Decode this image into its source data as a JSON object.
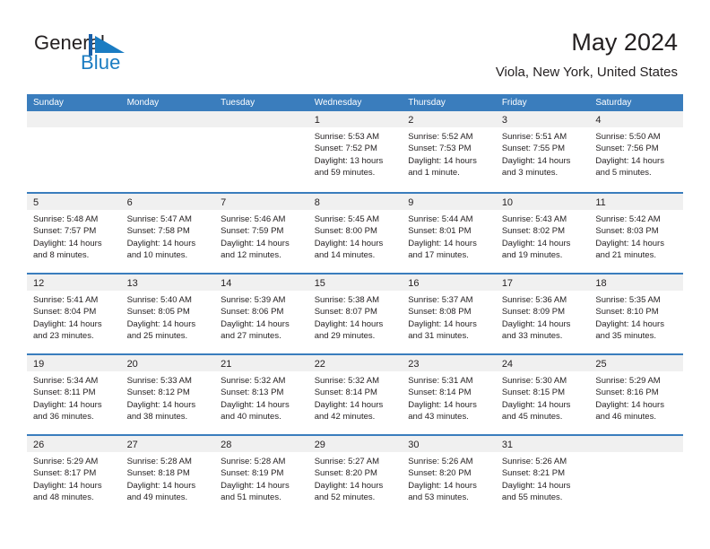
{
  "brand": {
    "name_part1": "General",
    "name_part2": "Blue",
    "logo_icon": "blue-triangle-flag-icon",
    "accent_color": "#1a7cc2"
  },
  "header": {
    "title": "May 2024",
    "subtitle": "Viola, New York, United States"
  },
  "theme": {
    "header_blue": "#3a7dbd",
    "day_strip_gray": "#f0f0f0",
    "text_color": "#231f20"
  },
  "calendar": {
    "weekdays": [
      "Sunday",
      "Monday",
      "Tuesday",
      "Wednesday",
      "Thursday",
      "Friday",
      "Saturday"
    ],
    "weeks": [
      [
        {
          "day": "",
          "lines": []
        },
        {
          "day": "",
          "lines": []
        },
        {
          "day": "",
          "lines": []
        },
        {
          "day": "1",
          "lines": [
            "Sunrise: 5:53 AM",
            "Sunset: 7:52 PM",
            "Daylight: 13 hours",
            "and 59 minutes."
          ]
        },
        {
          "day": "2",
          "lines": [
            "Sunrise: 5:52 AM",
            "Sunset: 7:53 PM",
            "Daylight: 14 hours",
            "and 1 minute."
          ]
        },
        {
          "day": "3",
          "lines": [
            "Sunrise: 5:51 AM",
            "Sunset: 7:55 PM",
            "Daylight: 14 hours",
            "and 3 minutes."
          ]
        },
        {
          "day": "4",
          "lines": [
            "Sunrise: 5:50 AM",
            "Sunset: 7:56 PM",
            "Daylight: 14 hours",
            "and 5 minutes."
          ]
        }
      ],
      [
        {
          "day": "5",
          "lines": [
            "Sunrise: 5:48 AM",
            "Sunset: 7:57 PM",
            "Daylight: 14 hours",
            "and 8 minutes."
          ]
        },
        {
          "day": "6",
          "lines": [
            "Sunrise: 5:47 AM",
            "Sunset: 7:58 PM",
            "Daylight: 14 hours",
            "and 10 minutes."
          ]
        },
        {
          "day": "7",
          "lines": [
            "Sunrise: 5:46 AM",
            "Sunset: 7:59 PM",
            "Daylight: 14 hours",
            "and 12 minutes."
          ]
        },
        {
          "day": "8",
          "lines": [
            "Sunrise: 5:45 AM",
            "Sunset: 8:00 PM",
            "Daylight: 14 hours",
            "and 14 minutes."
          ]
        },
        {
          "day": "9",
          "lines": [
            "Sunrise: 5:44 AM",
            "Sunset: 8:01 PM",
            "Daylight: 14 hours",
            "and 17 minutes."
          ]
        },
        {
          "day": "10",
          "lines": [
            "Sunrise: 5:43 AM",
            "Sunset: 8:02 PM",
            "Daylight: 14 hours",
            "and 19 minutes."
          ]
        },
        {
          "day": "11",
          "lines": [
            "Sunrise: 5:42 AM",
            "Sunset: 8:03 PM",
            "Daylight: 14 hours",
            "and 21 minutes."
          ]
        }
      ],
      [
        {
          "day": "12",
          "lines": [
            "Sunrise: 5:41 AM",
            "Sunset: 8:04 PM",
            "Daylight: 14 hours",
            "and 23 minutes."
          ]
        },
        {
          "day": "13",
          "lines": [
            "Sunrise: 5:40 AM",
            "Sunset: 8:05 PM",
            "Daylight: 14 hours",
            "and 25 minutes."
          ]
        },
        {
          "day": "14",
          "lines": [
            "Sunrise: 5:39 AM",
            "Sunset: 8:06 PM",
            "Daylight: 14 hours",
            "and 27 minutes."
          ]
        },
        {
          "day": "15",
          "lines": [
            "Sunrise: 5:38 AM",
            "Sunset: 8:07 PM",
            "Daylight: 14 hours",
            "and 29 minutes."
          ]
        },
        {
          "day": "16",
          "lines": [
            "Sunrise: 5:37 AM",
            "Sunset: 8:08 PM",
            "Daylight: 14 hours",
            "and 31 minutes."
          ]
        },
        {
          "day": "17",
          "lines": [
            "Sunrise: 5:36 AM",
            "Sunset: 8:09 PM",
            "Daylight: 14 hours",
            "and 33 minutes."
          ]
        },
        {
          "day": "18",
          "lines": [
            "Sunrise: 5:35 AM",
            "Sunset: 8:10 PM",
            "Daylight: 14 hours",
            "and 35 minutes."
          ]
        }
      ],
      [
        {
          "day": "19",
          "lines": [
            "Sunrise: 5:34 AM",
            "Sunset: 8:11 PM",
            "Daylight: 14 hours",
            "and 36 minutes."
          ]
        },
        {
          "day": "20",
          "lines": [
            "Sunrise: 5:33 AM",
            "Sunset: 8:12 PM",
            "Daylight: 14 hours",
            "and 38 minutes."
          ]
        },
        {
          "day": "21",
          "lines": [
            "Sunrise: 5:32 AM",
            "Sunset: 8:13 PM",
            "Daylight: 14 hours",
            "and 40 minutes."
          ]
        },
        {
          "day": "22",
          "lines": [
            "Sunrise: 5:32 AM",
            "Sunset: 8:14 PM",
            "Daylight: 14 hours",
            "and 42 minutes."
          ]
        },
        {
          "day": "23",
          "lines": [
            "Sunrise: 5:31 AM",
            "Sunset: 8:14 PM",
            "Daylight: 14 hours",
            "and 43 minutes."
          ]
        },
        {
          "day": "24",
          "lines": [
            "Sunrise: 5:30 AM",
            "Sunset: 8:15 PM",
            "Daylight: 14 hours",
            "and 45 minutes."
          ]
        },
        {
          "day": "25",
          "lines": [
            "Sunrise: 5:29 AM",
            "Sunset: 8:16 PM",
            "Daylight: 14 hours",
            "and 46 minutes."
          ]
        }
      ],
      [
        {
          "day": "26",
          "lines": [
            "Sunrise: 5:29 AM",
            "Sunset: 8:17 PM",
            "Daylight: 14 hours",
            "and 48 minutes."
          ]
        },
        {
          "day": "27",
          "lines": [
            "Sunrise: 5:28 AM",
            "Sunset: 8:18 PM",
            "Daylight: 14 hours",
            "and 49 minutes."
          ]
        },
        {
          "day": "28",
          "lines": [
            "Sunrise: 5:28 AM",
            "Sunset: 8:19 PM",
            "Daylight: 14 hours",
            "and 51 minutes."
          ]
        },
        {
          "day": "29",
          "lines": [
            "Sunrise: 5:27 AM",
            "Sunset: 8:20 PM",
            "Daylight: 14 hours",
            "and 52 minutes."
          ]
        },
        {
          "day": "30",
          "lines": [
            "Sunrise: 5:26 AM",
            "Sunset: 8:20 PM",
            "Daylight: 14 hours",
            "and 53 minutes."
          ]
        },
        {
          "day": "31",
          "lines": [
            "Sunrise: 5:26 AM",
            "Sunset: 8:21 PM",
            "Daylight: 14 hours",
            "and 55 minutes."
          ]
        },
        {
          "day": "",
          "lines": []
        }
      ]
    ]
  }
}
